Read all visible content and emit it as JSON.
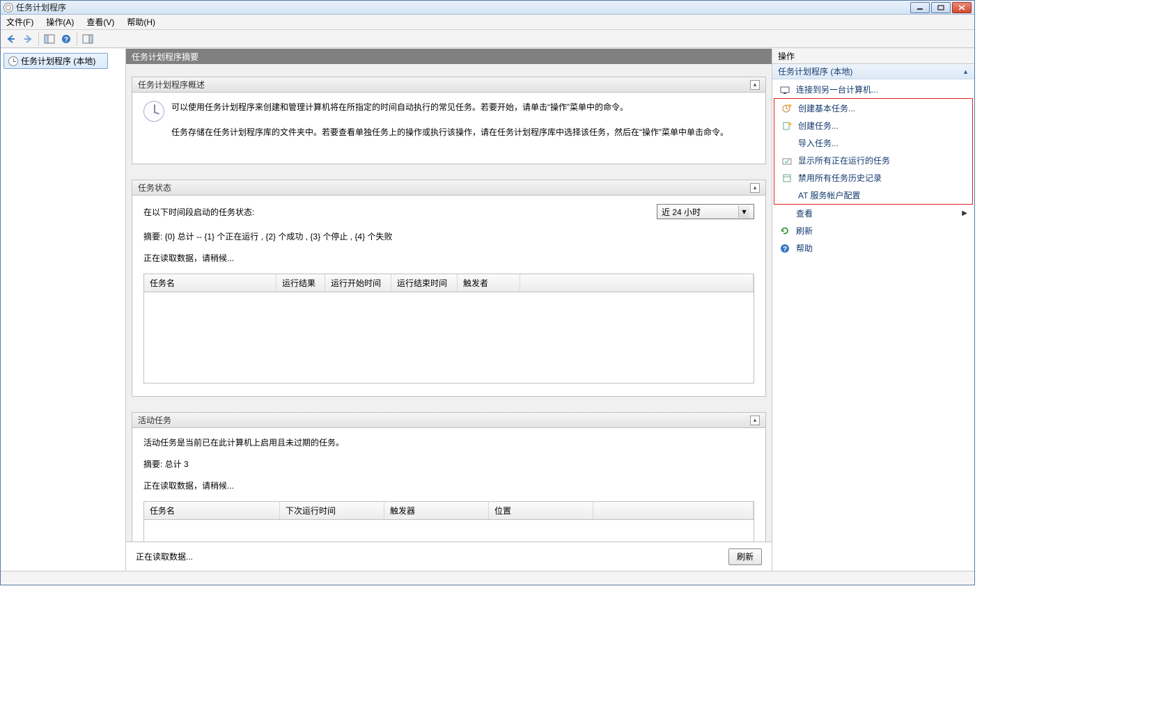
{
  "title": "任务计划程序",
  "menu": {
    "file": "文件(F)",
    "action": "操作(A)",
    "view": "查看(V)",
    "help": "帮助(H)"
  },
  "tree": {
    "root": "任务计划程序 (本地)"
  },
  "center": {
    "header": "任务计划程序摘要",
    "overview": {
      "title": "任务计划程序概述",
      "line1": "可以使用任务计划程序来创建和管理计算机将在所指定的时间自动执行的常见任务。若要开始，请单击“操作”菜单中的命令。",
      "line2": "任务存储在任务计划程序库的文件夹中。若要查看单独任务上的操作或执行该操作，请在任务计划程序库中选择该任务，然后在“操作”菜单中单击命令。"
    },
    "status": {
      "title": "任务状态",
      "prompt": "在以下时间段启动的任务状态:",
      "select_value": "近 24 小时",
      "summary": "摘要:  {0} 总计 -- {1} 个正在运行 , {2} 个成功 , {3} 个停止 , {4} 个失败",
      "loading": "正在读取数据，请稍候...",
      "cols": {
        "c1": "任务名",
        "c2": "运行结果",
        "c3": "运行开始时间",
        "c4": "运行结束时间",
        "c5": "触发者"
      }
    },
    "active": {
      "title": "活动任务",
      "desc": "活动任务是当前已在此计算机上启用且未过期的任务。",
      "summary": "摘要: 总计 3",
      "loading": "正在读取数据，请稍候...",
      "cols": {
        "c1": "任务名",
        "c2": "下次运行时间",
        "c3": "触发器",
        "c4": "位置"
      }
    },
    "footer": {
      "loading": "正在读取数据...",
      "refresh": "刷新"
    }
  },
  "actions": {
    "title": "操作",
    "subhead": "任务计划程序 (本地)",
    "items": {
      "connect": "连接到另一台计算机...",
      "create_basic": "创建基本任务...",
      "create_task": "创建任务...",
      "import": "导入任务...",
      "show_running": "显示所有正在运行的任务",
      "disable_history": "禁用所有任务历史记录",
      "at_config": "AT 服务帐户配置",
      "view": "查看",
      "refresh": "刷新",
      "help": "帮助"
    }
  }
}
